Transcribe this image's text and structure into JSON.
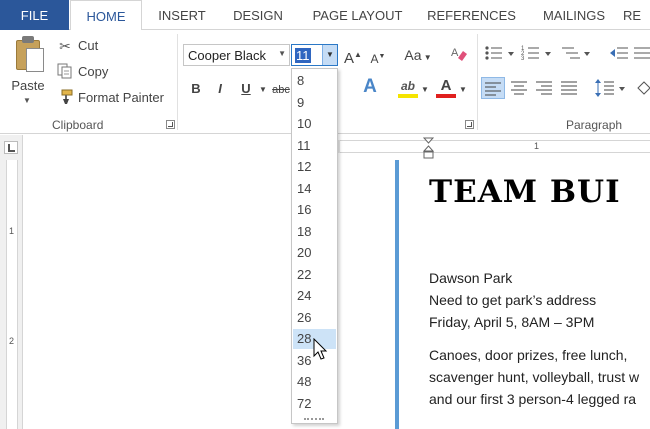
{
  "tabs": [
    {
      "label": "FILE",
      "active": false
    },
    {
      "label": "HOME",
      "active": true
    },
    {
      "label": "INSERT",
      "active": false
    },
    {
      "label": "DESIGN",
      "active": false
    },
    {
      "label": "PAGE LAYOUT",
      "active": false
    },
    {
      "label": "REFERENCES",
      "active": false
    },
    {
      "label": "MAILINGS",
      "active": false
    },
    {
      "label": "RE",
      "active": false
    }
  ],
  "clipboard": {
    "paste_label": "Paste",
    "cut_label": "Cut",
    "copy_label": "Copy",
    "format_painter_label": "Format Painter",
    "group_label": "Clipboard"
  },
  "font": {
    "font_name": "Cooper Black",
    "font_size": "11",
    "bold_label": "B",
    "italic_label": "I",
    "underline_label": "U",
    "strike_label": "abc",
    "change_case_label": "Aa",
    "grow_label": "A",
    "shrink_label": "A",
    "effects_label": "A",
    "highlight_label": "ab",
    "color_label": "A"
  },
  "paragraph": {
    "group_label": "Paragraph"
  },
  "size_dropdown": {
    "options": [
      "8",
      "9",
      "10",
      "11",
      "12",
      "14",
      "16",
      "18",
      "20",
      "22",
      "24",
      "26",
      "28",
      "36",
      "48",
      "72"
    ],
    "highlighted": "28"
  },
  "rulers": {
    "vertical_numbers": [
      "1",
      "2"
    ],
    "horizontal_numbers": [
      "1"
    ]
  },
  "document": {
    "title": "TEAM BUI",
    "lines": [
      "Dawson Park",
      "Need to get park’s address",
      "Friday, April 5, 8AM – 3PM",
      "Canoes, door prizes, free lunch,",
      "scavenger hunt, volleyball, trust w",
      "and our first 3 person-4 legged ra"
    ]
  },
  "colors": {
    "file_tab": "#2b579a",
    "accent": "#2b579a",
    "highlight_yellow": "#f5e400",
    "font_color_red": "#e0201e",
    "page_bar": "#5b9bd5",
    "dropdown_highlight": "#cde3f7"
  },
  "icons": {
    "cut": "scissors-icon",
    "copy": "copy-icon",
    "format_painter": "paintbrush-icon",
    "clear_formatting": "eraser-icon"
  }
}
